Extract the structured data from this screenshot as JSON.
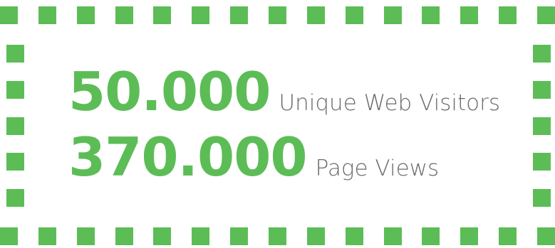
{
  "theme": {
    "accent": "#5cbd56",
    "label_color": "#6b6b6b",
    "background": "#ffffff"
  },
  "stats": [
    {
      "value": "50.000",
      "label": "Unique Web Visitors"
    },
    {
      "value": "370.000",
      "label": "Page Views"
    }
  ]
}
